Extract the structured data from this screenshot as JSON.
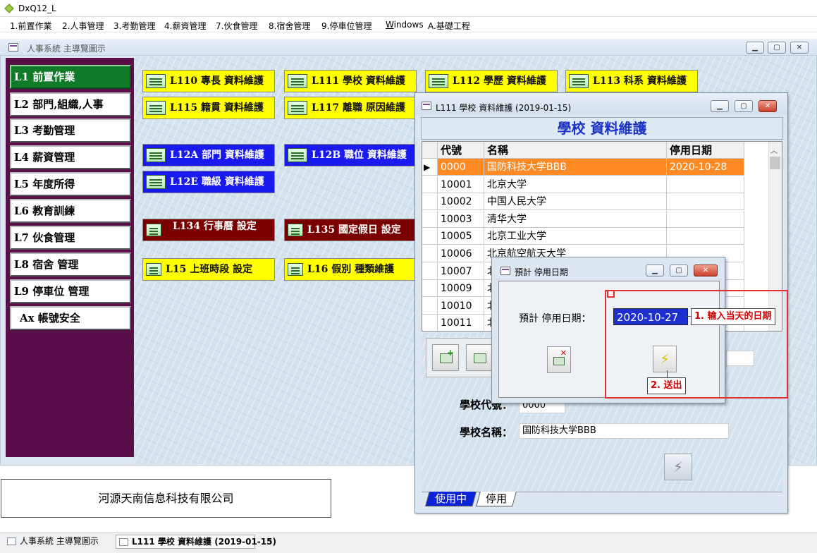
{
  "app": {
    "title": "DxQ12_L"
  },
  "menu": [
    "1.前置作業",
    "2.人事管理",
    "3.考勤管理",
    "4.薪資管理",
    "7.伙食管理",
    "8.宿舍管理",
    "9.停車位管理",
    "Windows",
    "A.基礎工程"
  ],
  "main_window": {
    "title": "人事系統 主導覽圖示"
  },
  "nav": [
    "L1 前置作業",
    "L2 部門,組織,人事",
    "L3 考勤管理",
    "L4 薪資管理",
    "L5 年度所得",
    "L6 教育訓練",
    "L7 伙食管理",
    "L8 宿舍 管理",
    "L9 停車位 管理",
    "Ax 帳號安全"
  ],
  "buttons": {
    "L110": "L110 專長 資料維護",
    "L111": "L111 學校 資料維護",
    "L112": "L112 學歷 資料維護",
    "L113": "L113 科系 資料維護",
    "L115": "L115 籍貫 資料維護",
    "L117": "L117 離職 原因維護",
    "L12A": "L12A 部門 資料維護",
    "L12B": "L12B 職位 資料維護",
    "L12E": "L12E 職級 資料維護",
    "L134": "L134 行事曆 設定",
    "L135": "L135 國定假日 設定",
    "L15": "L15 上班時段 設定",
    "L16": "L16 假別 種類維護"
  },
  "l111": {
    "title": "L111 學校 資料維護 (2019-01-15)",
    "header": "學校 資料維護",
    "columns": [
      "代號",
      "名稱",
      "停用日期"
    ],
    "rows": [
      {
        "code": "0000",
        "name": "国防科技大学BBB",
        "stop": "2020-10-28"
      },
      {
        "code": "10001",
        "name": "北京大学",
        "stop": ""
      },
      {
        "code": "10002",
        "name": "中国人民大学",
        "stop": ""
      },
      {
        "code": "10003",
        "name": "清华大学",
        "stop": ""
      },
      {
        "code": "10005",
        "name": "北京工业大学",
        "stop": ""
      },
      {
        "code": "10006",
        "name": "北京航空航天大学",
        "stop": ""
      },
      {
        "code": "10007",
        "name": "北",
        "stop": ""
      },
      {
        "code": "10009",
        "name": "北",
        "stop": ""
      },
      {
        "code": "10010",
        "name": "北",
        "stop": ""
      },
      {
        "code": "10011",
        "name": "北",
        "stop": ""
      }
    ],
    "code_label": "學校代號：",
    "code_value": "0000",
    "name_label": "學校名稱：",
    "name_value": "国防科技大学BBB",
    "tabs": [
      "使用中",
      "停用"
    ]
  },
  "dialog": {
    "title": "預計 停用日期",
    "label": "預計 停用日期：",
    "date": "2020-10-27"
  },
  "annotations": {
    "step1": "1. 输入当天的日期",
    "step2": "2. 送出",
    "color": "#e03030"
  },
  "company": "河源天南信息科技有限公司",
  "taskbar": [
    "人事系統 主導覽圖示",
    "L111 學校 資料維護 (2019-01-15)"
  ]
}
